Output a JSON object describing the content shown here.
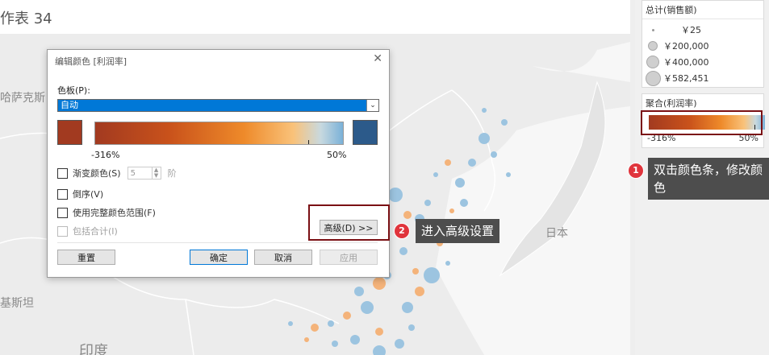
{
  "worksheet": {
    "title": "作表 34"
  },
  "map": {
    "labels": [
      "哈萨克斯",
      "日本",
      "基斯坦",
      "印度"
    ]
  },
  "legend_size": {
    "title": "总计(销售额)",
    "items": [
      {
        "label": "￥25"
      },
      {
        "label": "￥200,000"
      },
      {
        "label": "￥400,000"
      },
      {
        "label": "￥582,451"
      }
    ]
  },
  "legend_color": {
    "title": "聚合(利润率)",
    "min_label": "-316%",
    "max_label": "50%",
    "colors": {
      "low": "#a23a20",
      "high": "#7ab1d8"
    }
  },
  "dialog": {
    "title": "编辑颜色 [利润率]",
    "palette_label": "色板(P):",
    "palette_value": "自动",
    "min_label": "-316%",
    "max_label": "50%",
    "swatch_low": "#a23a20",
    "swatch_high": "#2c5a8a",
    "stepped_label": "渐变颜色(S)",
    "stepped_value": "5",
    "stepped_unit": "阶",
    "reversed_label": "倒序(V)",
    "full_range_label": "使用完整颜色范围(F)",
    "include_totals_label": "包括合计(I)",
    "advanced_button": "高级(D) >>",
    "reset_button": "重置",
    "ok_button": "确定",
    "cancel_button": "取消",
    "apply_button": "应用"
  },
  "callouts": [
    {
      "number": "1",
      "text": "双击颜色条，修改颜色"
    },
    {
      "number": "2",
      "text": "进入高级设置"
    }
  ]
}
